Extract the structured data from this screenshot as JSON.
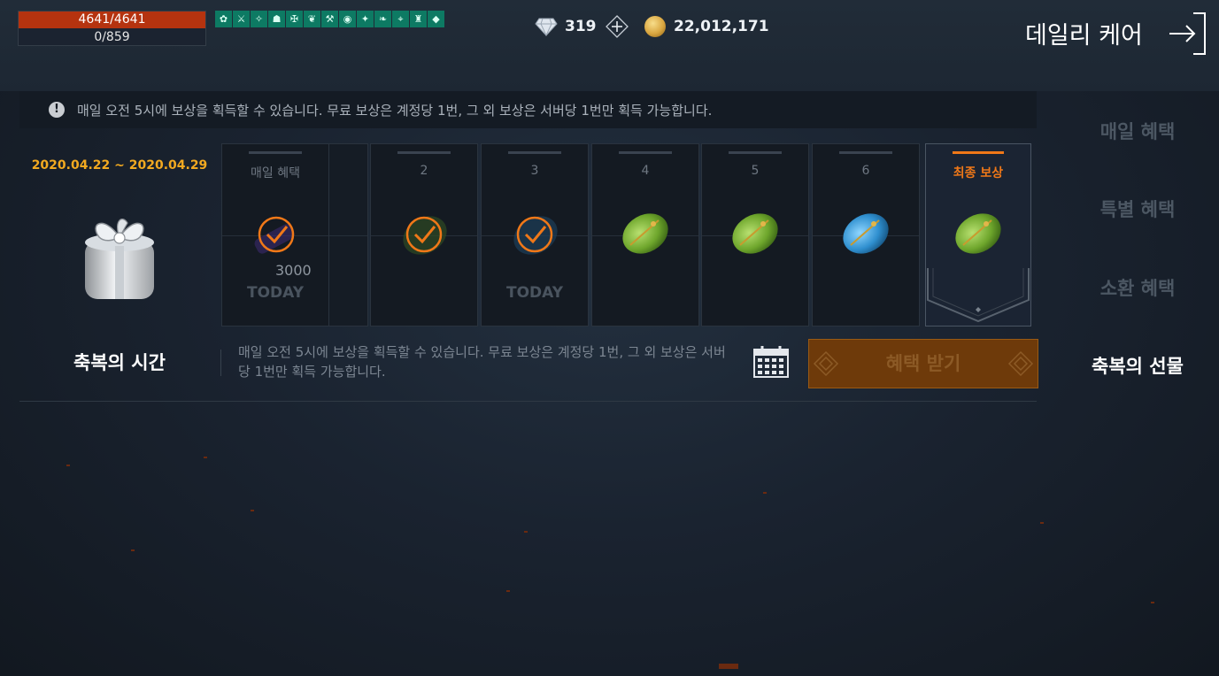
{
  "status": {
    "hp": "4641/4641",
    "mp": "0/859",
    "hp_fraction": 1.0
  },
  "buffs": [
    "✿",
    "⚔",
    "✧",
    "☗",
    "✠",
    "❦",
    "⚒",
    "◉",
    "✦",
    "❧",
    "⌖",
    "♜",
    "◆"
  ],
  "currency": {
    "gems": "319",
    "gold": "22,012,171"
  },
  "screen_title": "데일리 케어",
  "notice": "매일 오전 5시에 보상을 획득할 수 있습니다. 무료 보상은 계정당 1번, 그 외 보상은 서버당 1번만 획득 가능합니다.",
  "event": {
    "period": "2020.04.22 ~ 2020.04.29",
    "name": "축복의 시간",
    "description": "매일 오전 5시에 보상을 획득할 수 있습니다. 무료 보상은 계정당 1번, 그 외 보상은 서버당 1번만 획득 가능합니다.",
    "claim_label": "혜택 받기"
  },
  "cards": {
    "first_label": "매일 혜택",
    "first_qty": "3000",
    "first_today": "TODAY",
    "day2": "2",
    "day3": "3",
    "day3_today": "TODAY",
    "day4": "4",
    "day5": "5",
    "day6": "6",
    "final": "최종 보상"
  },
  "side_tabs": [
    "매일 혜택",
    "특별 혜택",
    "소환 혜택",
    "축복의 선물"
  ],
  "colors": {
    "accent": "#f07818",
    "period": "#f2a920",
    "hp": "#b5330f",
    "buff": "#0d7a63"
  }
}
